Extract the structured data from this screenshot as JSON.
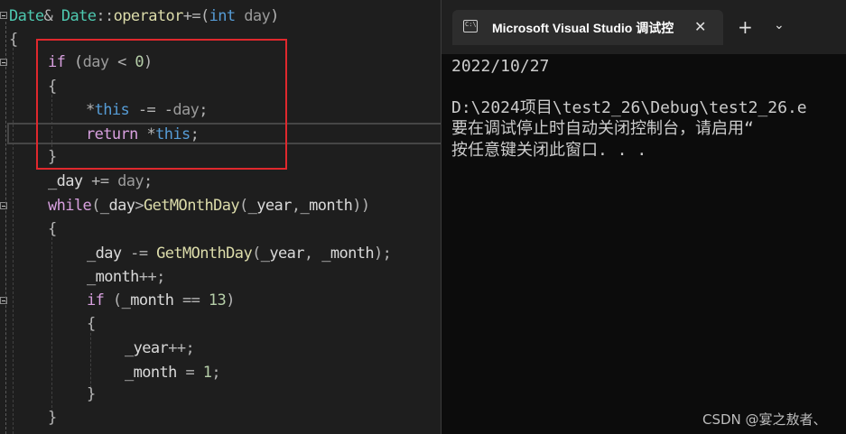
{
  "editor": {
    "lines": [
      {
        "parts": [
          [
            "ty",
            "Date"
          ],
          [
            "op",
            "& "
          ],
          [
            "ty",
            "Date"
          ],
          [
            "op",
            "::"
          ],
          [
            "fn",
            "operator"
          ],
          [
            "op",
            "+=("
          ],
          [
            "kw",
            "int"
          ],
          [
            "var",
            " "
          ],
          [
            "pm",
            "day"
          ],
          [
            "op",
            ")"
          ]
        ]
      },
      {
        "parts": [
          [
            "op",
            "{"
          ]
        ]
      },
      {
        "parts": [
          [
            "ctl",
            "if"
          ],
          [
            "op",
            " ("
          ],
          [
            "pm",
            "day"
          ],
          [
            "op",
            " < "
          ],
          [
            "num",
            "0"
          ],
          [
            "op",
            ")"
          ]
        ]
      },
      {
        "parts": [
          [
            "op",
            "{"
          ]
        ]
      },
      {
        "parts": [
          [
            "op",
            "*"
          ],
          [
            "kw",
            "this"
          ],
          [
            "op",
            " -= -"
          ],
          [
            "pm",
            "day"
          ],
          [
            "op",
            ";"
          ]
        ]
      },
      {
        "parts": [
          [
            "ctl",
            "return"
          ],
          [
            "op",
            " *"
          ],
          [
            "kw",
            "this"
          ],
          [
            "op",
            ";"
          ]
        ]
      },
      {
        "parts": [
          [
            "op",
            "}"
          ]
        ]
      },
      {
        "parts": [
          [
            "var",
            "_day"
          ],
          [
            "op",
            " += "
          ],
          [
            "pm",
            "day"
          ],
          [
            "op",
            ";"
          ]
        ]
      },
      {
        "parts": [
          [
            "ctl",
            "while"
          ],
          [
            "op",
            "("
          ],
          [
            "var",
            "_day"
          ],
          [
            "op",
            ">"
          ],
          [
            "fn",
            "GetMOnthDay"
          ],
          [
            "op",
            "("
          ],
          [
            "var",
            "_year"
          ],
          [
            "op",
            ","
          ],
          [
            "var",
            "_month"
          ],
          [
            "op",
            "))"
          ]
        ]
      },
      {
        "parts": [
          [
            "op",
            "{"
          ]
        ]
      },
      {
        "parts": [
          [
            "var",
            "_day"
          ],
          [
            "op",
            " -= "
          ],
          [
            "fn",
            "GetMOnthDay"
          ],
          [
            "op",
            "("
          ],
          [
            "var",
            "_year"
          ],
          [
            "op",
            ", "
          ],
          [
            "var",
            "_month"
          ],
          [
            "op",
            ");"
          ]
        ]
      },
      {
        "parts": [
          [
            "var",
            "_month"
          ],
          [
            "op",
            "++;"
          ]
        ]
      },
      {
        "parts": [
          [
            "ctl",
            "if"
          ],
          [
            "op",
            " ("
          ],
          [
            "var",
            "_month"
          ],
          [
            "op",
            " == "
          ],
          [
            "num",
            "13"
          ],
          [
            "op",
            ")"
          ]
        ]
      },
      {
        "parts": [
          [
            "op",
            "{"
          ]
        ]
      },
      {
        "parts": [
          [
            "var",
            "_year"
          ],
          [
            "op",
            "++;"
          ]
        ]
      },
      {
        "parts": [
          [
            "var",
            "_month"
          ],
          [
            "op",
            " = "
          ],
          [
            "num",
            "1"
          ],
          [
            "op",
            ";"
          ]
        ]
      },
      {
        "parts": [
          [
            "op",
            "}"
          ]
        ]
      },
      {
        "parts": [
          [
            "op",
            "}"
          ]
        ]
      }
    ]
  },
  "console": {
    "tab_title": "Microsoft Visual Studio 调试控",
    "tab_icon_glyph": "C:\\",
    "close_glyph": "✕",
    "new_tab_glyph": "+",
    "dropdown_glyph": "⌄",
    "output": {
      "date": "2022/10/27",
      "path": "D:\\2024项目\\test2_26\\Debug\\test2_26.e",
      "hint1": "要在调试停止时自动关闭控制台，请启用“",
      "hint2": "按任意键关闭此窗口. . ."
    }
  },
  "watermark": "CSDN @宴之敖者、",
  "colors": {
    "editor_bg": "#1e1e1e",
    "console_bg": "#0c0c0c",
    "highlight_border": "#e0282d",
    "keyword": "#569cd6",
    "control": "#d8a0df",
    "type": "#4ec9b0",
    "function": "#dcdcaa",
    "number": "#b5cea8"
  }
}
